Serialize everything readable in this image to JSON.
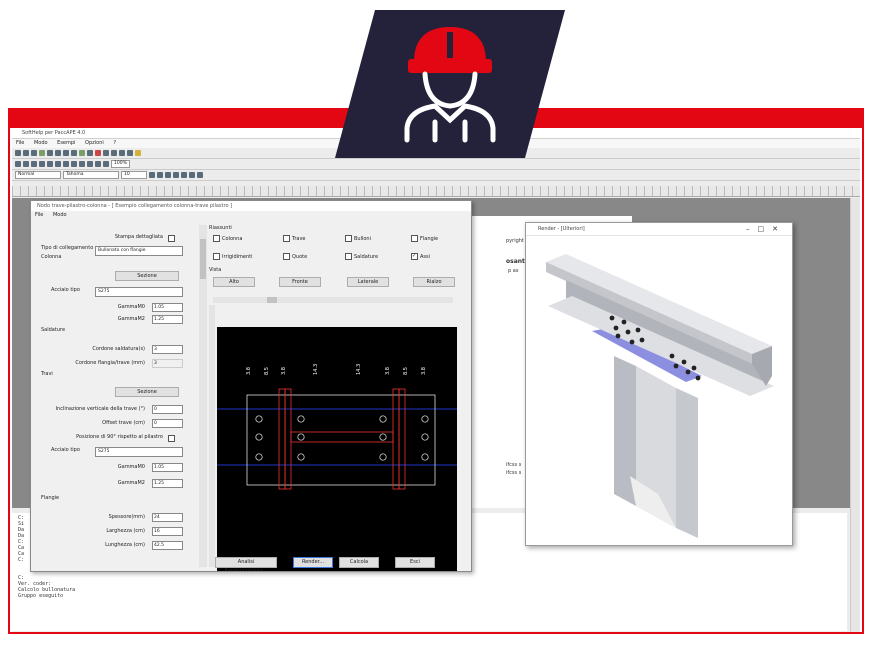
{
  "badge": {
    "icon": "worker-helmet-icon",
    "bg": "#23223a",
    "icon_color": "#e30613",
    "person_color": "#ffffff"
  },
  "colors": {
    "frame": "#e30613"
  },
  "app": {
    "title": "SoftHelp per PaccAPE 4.0",
    "menu": [
      "File",
      "Modo",
      "Esempi",
      "Opzioni",
      "?"
    ],
    "font_name": "Normal",
    "font_family": "Tahoma",
    "font_size": "10",
    "zoom": "100%"
  },
  "document": {
    "copyright": "pyright (c) 2001",
    "heading": "osante",
    "sub": "p as",
    "note1": "ifcss s",
    "note2": "ifcss s"
  },
  "console": {
    "lines": [
      "C:",
      "Si",
      "Da",
      "Da",
      "C:",
      "Ca",
      "Ca",
      "C:",
      "",
      "",
      "C:",
      "Ver. coder:",
      "Calcolo bullonatura",
      "Gruppo eseguito"
    ]
  },
  "dialog": {
    "title": "Nodo trave-pilastro-colonna - [ Esempio collegamento colonna-trave pilastro ]",
    "menu": [
      "File",
      "Modo"
    ],
    "left": {
      "stampa_label": "Stampa dettagliata",
      "tipo_label": "Tipo di collegamento",
      "colonna_label": "Colonna",
      "tipo_value": "Bullonato con flangie",
      "sezione1": "Sezione",
      "acciaio_label": "Acciaio tipo",
      "acciaio_value": "S275",
      "gamma_m0": "GammaM0",
      "gamma_m0_value": "1.05",
      "gamma_m2": "GammaM2",
      "gamma_m2_value": "1.25",
      "saldature": "Saldature",
      "cordone_label": "Cordone saldatura(s)",
      "cordone_value": "3",
      "cordone_flangia_label": "Cordone flangia/trave (mm)",
      "cordone_flangia_value": "3",
      "travi": "Travi",
      "sezione2": "Sezione",
      "inclinazione_label": "Inclinazione verticale della trave (°)",
      "inclinazione_value": "0",
      "offset_label": "Offset trave (cm)",
      "offset_value": "0",
      "posizione_label": "Posizione di 90° rispetto al pilastro",
      "acciaio2_label": "Acciaio tipo",
      "acciaio2_value": "S275",
      "gamma2_m0_value": "1.05",
      "gamma2_m2_value": "1.25",
      "flangie": "Flangie",
      "spessore_label": "Spessore(mm)",
      "spessore_value": "24",
      "larghezza_label": "Larghezza (cm)",
      "larghezza_value": "16",
      "lunghezza_label": "Lunghezza (cm)",
      "lunghezza_value": "42.5"
    },
    "right": {
      "riassunti": "Riassunti",
      "checks": [
        {
          "label": "Colonna",
          "checked": false
        },
        {
          "label": "Trave",
          "checked": false
        },
        {
          "label": "Bulloni",
          "checked": false
        },
        {
          "label": "Flangie",
          "checked": false
        },
        {
          "label": "Irrigidimenti",
          "checked": false
        },
        {
          "label": "Quote",
          "checked": false
        },
        {
          "label": "Saldature",
          "checked": false
        },
        {
          "label": "Assi",
          "checked": true
        }
      ],
      "vista": "Vista",
      "views": [
        "Alto",
        "Fronte",
        "Laterale",
        "Rialzo"
      ],
      "dims": [
        "3.8",
        "8.5",
        "3.8",
        "14.3",
        "14.3",
        "3.8",
        "8.5",
        "3.8"
      ],
      "buttons": [
        "Analisi flangia/colonna...",
        "Render...",
        "Calcola",
        "Esci"
      ]
    }
  },
  "render": {
    "title": "Render - [Ulteriori]"
  }
}
